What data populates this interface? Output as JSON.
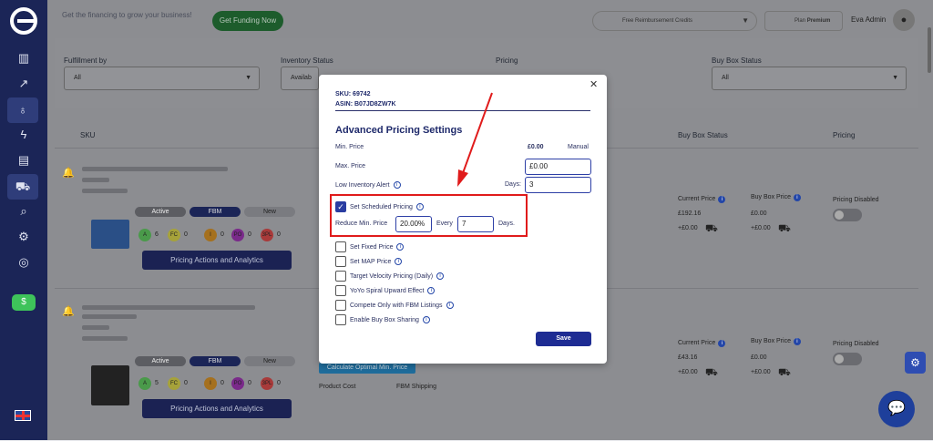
{
  "header": {
    "promo_text": "Get the financing to grow your business!",
    "funding_button": "Get Funding Now",
    "reimbursement": "Free Reimbursement Credits",
    "plan_label": "Plan",
    "plan_value": "Premium",
    "user_name": "Eva Admin"
  },
  "filters": {
    "fulfillment": {
      "label": "Fulfillment by",
      "value": "All"
    },
    "inventory": {
      "label": "Inventory Status",
      "value": "Availab"
    },
    "pricing": {
      "label": "Pricing"
    },
    "buybox": {
      "label": "Buy Box Status",
      "value": "All"
    }
  },
  "table": {
    "col_sku": "SKU",
    "col_buybox": "Buy Box Status",
    "col_pricing": "Pricing"
  },
  "rows": [
    {
      "badges": [
        "Active",
        "FBM",
        "New"
      ],
      "counts": [
        {
          "label": "A",
          "value": "6",
          "color": "#4a9a4a"
        },
        {
          "label": "FC",
          "value": "0",
          "color": "#a6a23a"
        },
        {
          "label": "I",
          "value": "0",
          "color": "#a5701e"
        },
        {
          "label": "PO",
          "value": "0",
          "color": "#7a2a8a"
        },
        {
          "label": "3PL",
          "value": "0",
          "color": "#a83a3a"
        }
      ],
      "actions_button": "Pricing Actions and Analytics",
      "current_price_label": "Current Price",
      "current_price": "£192.16",
      "current_delta": "+£0.00",
      "buybox_price_label": "Buy Box Price",
      "buybox_price": "£0.00",
      "buybox_delta": "+£0.00",
      "pricing_status": "Pricing Disabled"
    },
    {
      "badges": [
        "Active",
        "FBM",
        "New"
      ],
      "counts": [
        {
          "label": "A",
          "value": "5",
          "color": "#4a9a4a"
        },
        {
          "label": "FC",
          "value": "0",
          "color": "#a6a23a"
        },
        {
          "label": "I",
          "value": "0",
          "color": "#a5701e"
        },
        {
          "label": "PO",
          "value": "0",
          "color": "#7a2a8a"
        },
        {
          "label": "3PL",
          "value": "0",
          "color": "#a83a3a"
        }
      ],
      "actions_button": "Pricing Actions and Analytics",
      "calc_button": "Calculate Optimal Min. Price",
      "product_cost": "Product Cost",
      "fbm_shipping": "FBM Shipping",
      "current_price_label": "Current Price",
      "current_price": "£43.16",
      "current_delta": "+£0.00",
      "buybox_price_label": "Buy Box Price",
      "buybox_price": "£0.00",
      "buybox_delta": "+£0.00",
      "pricing_status": "Pricing Disabled"
    }
  ],
  "modal": {
    "sku": "SKU: 69742",
    "asin": "ASIN: B07JD8ZW7K",
    "title": "Advanced Pricing Settings",
    "min_price_label": "Min. Price",
    "min_price_value": "£0.00",
    "min_price_mode": "Manual",
    "max_price_label": "Max. Price",
    "max_price_value": "£0.00",
    "low_inv_label": "Low Inventory Alert",
    "days_label": "Days:",
    "days_value": "3",
    "scheduled_label": "Set Scheduled Pricing",
    "reduce_label": "Reduce Min. Price",
    "reduce_value": "20.00%",
    "every_label": "Every",
    "every_value": "7",
    "days_suffix": "Days.",
    "options": [
      "Set Fixed Price",
      "Set MAP Price",
      "Target Velocity Pricing (Daily)",
      "YoYo Spiral Upward Effect",
      "Compete Only with FBM Listings",
      "Enable Buy Box Sharing"
    ],
    "save": "Save"
  },
  "colors": {
    "sidebar": "#1b2557",
    "accent": "#1e2c93",
    "highlight": "#e01b1b"
  }
}
